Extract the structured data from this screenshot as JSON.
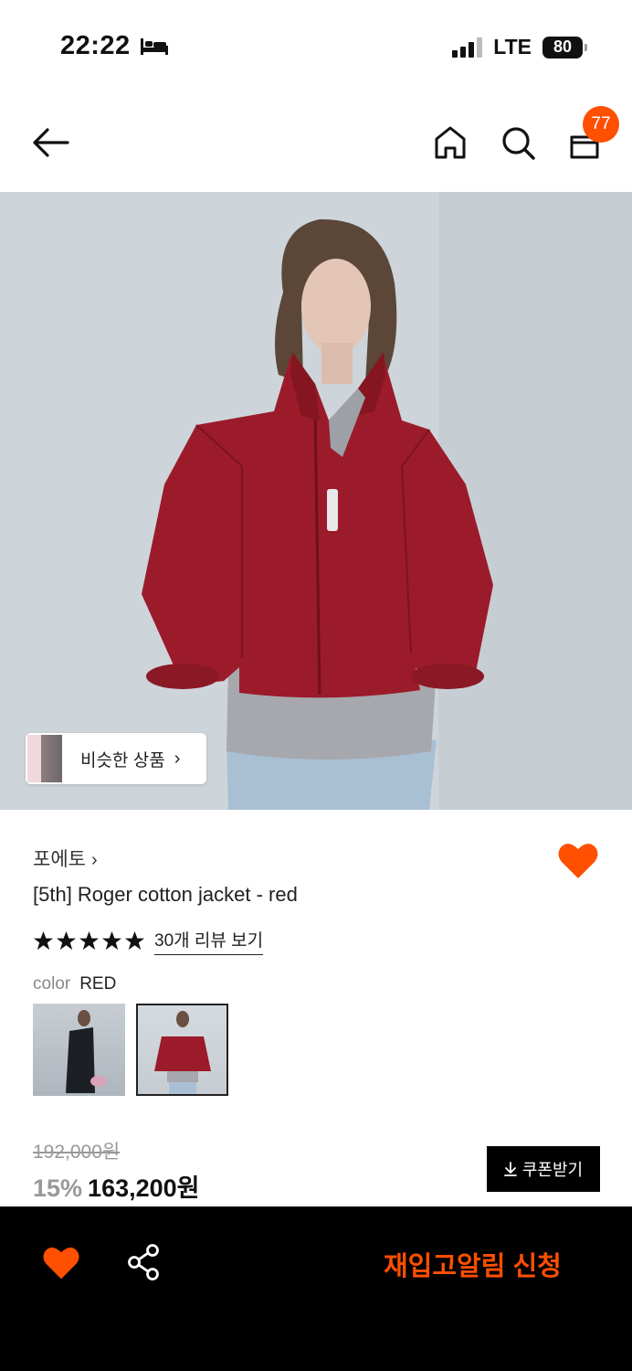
{
  "status_bar": {
    "time": "22:22",
    "network": "LTE",
    "battery": "80"
  },
  "nav": {
    "cart_count": "77"
  },
  "similar": {
    "label": "비슷한 상품",
    "chevron": "›"
  },
  "product": {
    "brand": "포에토",
    "brand_chevron": "›",
    "title": "[5th] Roger cotton jacket - red",
    "review_link": "30개 리뷰 보기",
    "rating": 5,
    "color_key": "color",
    "color_value": "RED",
    "original_price": "192,000원",
    "discount": "15%",
    "price": "163,200원",
    "coupon_label": "쿠폰받기"
  },
  "bottom_bar": {
    "restock_label": "재입고알림 신청"
  },
  "colors": {
    "accent": "#ff4f00",
    "black": "#000000"
  }
}
